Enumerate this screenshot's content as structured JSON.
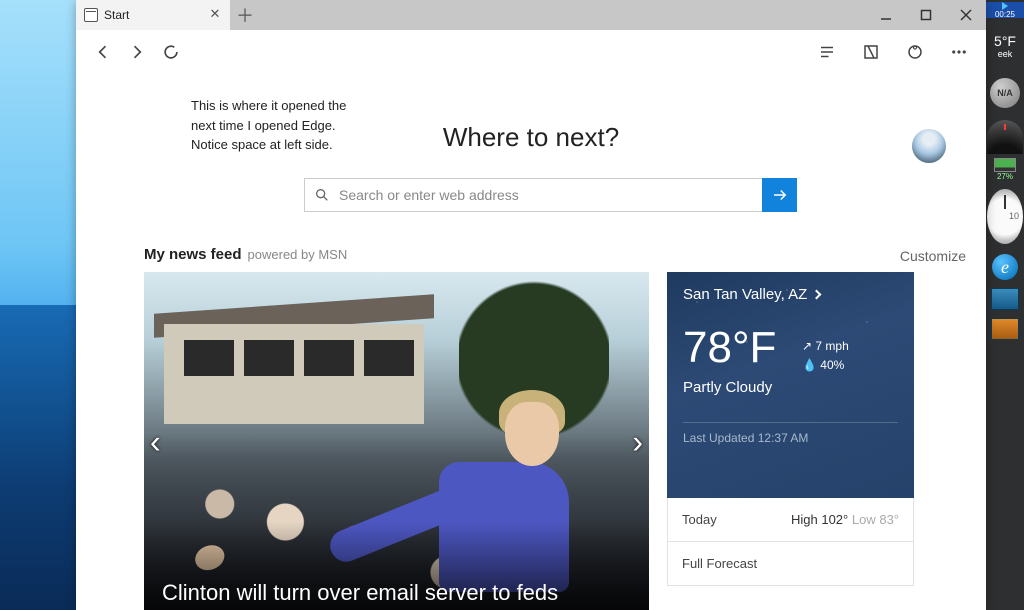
{
  "tab": {
    "title": "Start"
  },
  "note": {
    "line1": "This is where it opened the",
    "line2": "next time I opened Edge.",
    "line3": "Notice space at left side."
  },
  "heading": "Where to next?",
  "search": {
    "placeholder": "Search or enter web address"
  },
  "feed": {
    "title": "My news feed",
    "powered": "powered by MSN",
    "customize": "Customize"
  },
  "news": {
    "headline": "Clinton will turn over email server to feds"
  },
  "weather": {
    "location": "San Tan Valley, AZ",
    "temp": "78°F",
    "wind_label": "7 mph",
    "humidity_label": "40%",
    "condition": "Partly Cloudy",
    "updated": "Last Updated 12:37 AM",
    "today": {
      "label": "Today",
      "high": "High 102°",
      "low": "Low 83°"
    },
    "forecast": "Full Forecast"
  },
  "sidebar": {
    "time": "00:25",
    "temp": "5°F",
    "temp2": "eek",
    "na": "N/A",
    "pct": "27%",
    "dial": "10"
  }
}
